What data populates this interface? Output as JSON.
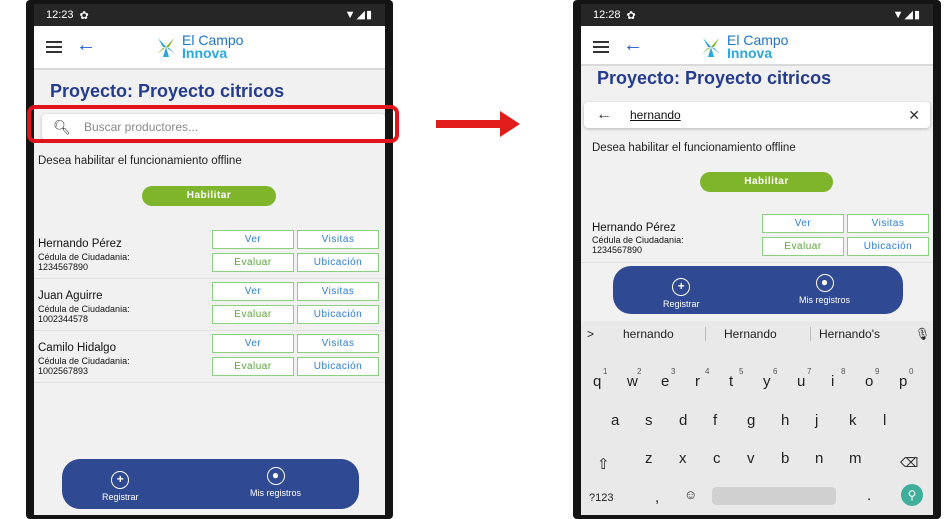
{
  "left": {
    "status": {
      "time": "12:23"
    },
    "logo": {
      "line1": "El Campo",
      "line2": "Innova"
    },
    "project_title": "Proyecto: Proyecto citricos",
    "search": {
      "placeholder": "Buscar productores..."
    },
    "offline_text": "Desea habilitar el funcionamiento offline",
    "habilitar": "Habilitar",
    "producers": [
      {
        "name": "Hernando Pérez",
        "id_label": "Cédula de Ciudadania:",
        "id": "1234567890"
      },
      {
        "name": "Juan Aguirre",
        "id_label": "Cédula de Ciudadania:",
        "id": "1002344578"
      },
      {
        "name": "Camilo Hidalgo",
        "id_label": "Cédula de Ciudadania:",
        "id": "1002567893"
      }
    ],
    "buttons": {
      "ver": "Ver",
      "visitas": "Visitas",
      "evaluar": "Evaluar",
      "ubicacion": "Ubicación"
    },
    "nav": {
      "registrar": "Registrar",
      "mis_registros": "Mis registros"
    }
  },
  "right": {
    "status": {
      "time": "12:28"
    },
    "logo": {
      "line1": "El Campo",
      "line2": "Innova"
    },
    "project_title": "Proyecto: Proyecto citricos",
    "search": {
      "value": "hernando"
    },
    "offline_text": "Desea habilitar el funcionamiento offline",
    "habilitar": "Habilitar",
    "producer": {
      "name": "Hernando Pérez",
      "id_label": "Cédula de Ciudadania:",
      "id": "1234567890"
    },
    "buttons": {
      "ver": "Ver",
      "visitas": "Visitas",
      "evaluar": "Evaluar",
      "ubicacion": "Ubicación"
    },
    "nav": {
      "registrar": "Registrar",
      "mis_registros": "Mis registros"
    },
    "keyboard": {
      "suggestions": [
        "hernando",
        "Hernando",
        "Hernando's"
      ],
      "row1": [
        "q",
        "w",
        "e",
        "r",
        "t",
        "y",
        "u",
        "i",
        "o",
        "p"
      ],
      "row1_nums": [
        "1",
        "2",
        "3",
        "4",
        "5",
        "6",
        "7",
        "8",
        "9",
        "0"
      ],
      "row2": [
        "a",
        "s",
        "d",
        "f",
        "g",
        "h",
        "j",
        "k",
        "l"
      ],
      "row3": [
        "z",
        "x",
        "c",
        "v",
        "b",
        "n",
        "m"
      ],
      "sym": "?123",
      "comma": ",",
      "period": "."
    }
  },
  "colors": {
    "primary": "#243b8e",
    "nav": "#2f4a93",
    "accent_green": "#7fb52b",
    "highlight": "#e0141c"
  }
}
